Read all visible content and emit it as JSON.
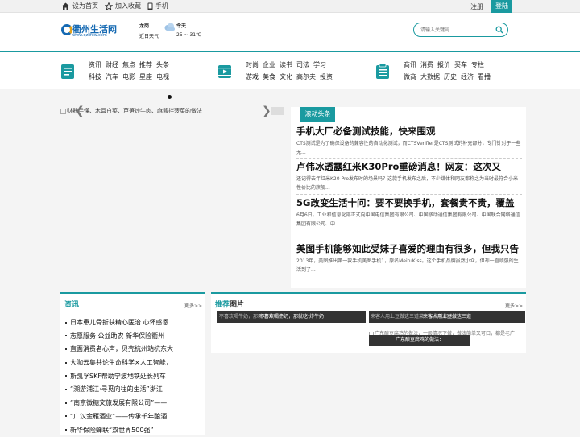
{
  "topbar": {
    "homepage": "设为首页",
    "favorite": "加入收藏",
    "mobile": "手机",
    "register": "注册",
    "login": "登陆"
  },
  "logo": {
    "name": "衢州生活网",
    "url": "www.qzlifew.com"
  },
  "weather": {
    "city": "龙岗",
    "recent": "近日天气",
    "today_label": "今天",
    "temperature": "25 ~ 31℃"
  },
  "search": {
    "placeholder": "请输入关键词"
  },
  "nav": {
    "group1": {
      "row1": [
        "资讯",
        "财经",
        "焦点",
        "推荐",
        "头条"
      ],
      "row2": [
        "科技",
        "汽车",
        "电影",
        "星座",
        "电视"
      ]
    },
    "group2": {
      "row1": [
        "时尚",
        "企业",
        "读书",
        "司法",
        "学习"
      ],
      "row2": [
        "游戏",
        "美食",
        "文化",
        "高尔夫",
        "投资"
      ]
    },
    "group3": {
      "row1": [
        "商讯",
        "消费",
        "报价",
        "买车",
        "专栏"
      ],
      "row2": [
        "微商",
        "大数据",
        "历史",
        "经济",
        "看播"
      ]
    }
  },
  "slider": {
    "caption": "财器手懂、木耳白菜、芦笋炒牛肉、麻酱拌菠菜的做法"
  },
  "news": {
    "tab": "滚动头条",
    "items": [
      {
        "title": "手机大厂必备测试技能，快来围观",
        "summary": "CTS测试是为了确保设备的兼容性的自动化测试，而CTSVerifier是CTS测试的补充部分，专门针对于一些无..."
      },
      {
        "title": "卢伟冰透露红米K30Pro重磅消息！网友：这次又",
        "summary": "还记得去年红米K20 Pro发布时的场景吗？这款手机发布之后，不少媒体和网友都称之为当时最符合小米性价比的旗舰..."
      },
      {
        "title": "5G改变生活十问：要不要换手机，套餐贵不贵，覆盖",
        "summary": "6月6日，工业和信息化部正式向中国电信集团有限公司、中国移动通信集团有限公司、中国联合网络通信集团有限公司、中..."
      },
      {
        "title": "美图手机能够如此受妹子喜爱的理由有很多，但我只告",
        "summary": "2013年，美图推出第一款手机美图手机1，原名MeituKiss。这个手机品牌虽然小众，但却一直顽强的生活到了..."
      }
    ]
  },
  "info": {
    "title": "资讯",
    "more": "更多>>",
    "items": [
      "日本患儿骨折获精心医治 心怀感恩",
      "志愿服务 公益助农 新华保险衢州",
      "直面消费者心声，贝壳杭州站杭东大",
      "大咖云集共论生命科学×人工智能，",
      "斯凯孚SKF帮助宁波地铁延长列车",
      "“溯游浦江·寻觅向往的生活”浙江",
      "“南京微糖文旅发展有限公司”——",
      "“广汉金雁酒业”——传承千年酿酒",
      "新华保险蝉联“双世界500强”！"
    ]
  },
  "pictures": {
    "title_accent": "推荐",
    "title_rest": "图片",
    "more": "更多>>",
    "items": [
      {
        "ghost": "不喜欢喝牛奶，那就吃·炸牛奶",
        "caption": "不喜欢喝牛奶，那就吃·炸牛奶"
      },
      {
        "ghost": "来客人用上豆做这三道菜，上桌就都抢",
        "caption": "来客人用上豆做这三道"
      },
      {
        "ghost": "广东酿豆腐鸡的做法，一般情况下做，做法简单又可口，都是老广",
        "caption": "广东酿豆腐鸡的做法："
      }
    ]
  }
}
